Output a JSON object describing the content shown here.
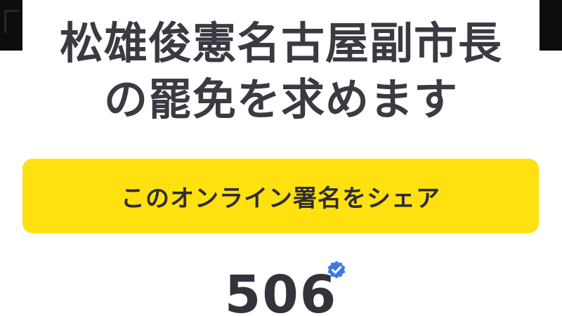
{
  "petition": {
    "title_line1": "松雄俊憲名古屋副市長",
    "title_line2": "の罷免を求めます"
  },
  "share": {
    "label": "このオンライン署名をシェア"
  },
  "signatures": {
    "count": "506",
    "verified_icon": "verified-badge-icon"
  },
  "colors": {
    "button": "#ffe10f",
    "text": "#3c3943",
    "badge": "#3e78e8"
  }
}
